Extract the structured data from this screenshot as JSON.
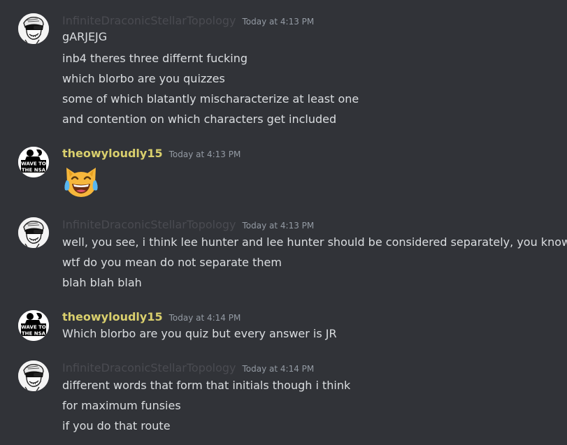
{
  "messages": [
    {
      "author": "InfiniteDraconicStellarTopology",
      "timestamp": "Today at 4:13 PM",
      "lines": [
        "gARJEJG",
        "inb4 theres three differnt fucking",
        "which blorbo are you quizzes",
        "some of which blatantly mischaracterize at least one",
        "and contention on which characters get included"
      ]
    },
    {
      "author": "theowyloudly15",
      "timestamp": "Today at 4:13 PM",
      "emoji": "joy-cat-emoji",
      "avatar_text": [
        "WAVE TO",
        "THE NSA"
      ]
    },
    {
      "author": "InfiniteDraconicStellarTopology",
      "timestamp": "Today at 4:13 PM",
      "lines": [
        "well, you see, i think lee hunter and lee hunter should be considered separately, you know",
        "wtf do you mean do not separate them",
        "blah blah blah"
      ]
    },
    {
      "author": "theowyloudly15",
      "timestamp": "Today at 4:14 PM",
      "lines": [
        "Which blorbo are you quiz but every answer is JR"
      ],
      "avatar_text": [
        "WAVE TO",
        "THE NSA"
      ]
    },
    {
      "author": "InfiniteDraconicStellarTopology",
      "timestamp": "Today at 4:14 PM",
      "lines": [
        "different words that form that initials though i think",
        "for maximum funsies",
        "if you do that route"
      ]
    }
  ],
  "colors": {
    "background": "#313338",
    "text": "#dbdee1",
    "timestamp": "#949ba4",
    "username_infinite": "#4a4b51",
    "username_theowy": "#d9cf6d"
  }
}
